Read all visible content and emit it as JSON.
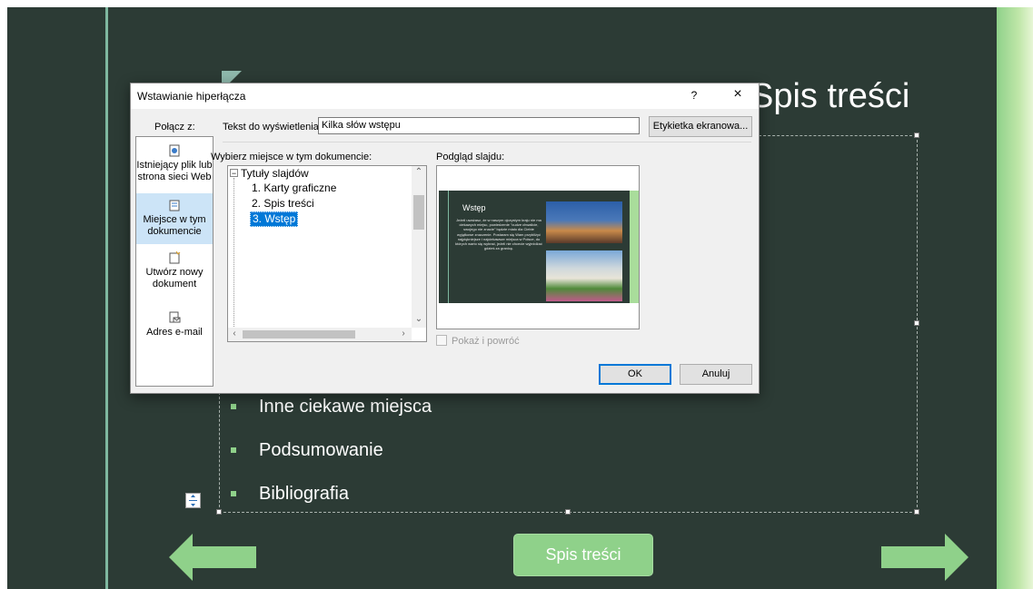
{
  "slide": {
    "title": "Spis treści",
    "bullets": [
      "Inne ciekawe miejsca",
      "Podsumowanie",
      "Bibliografia"
    ],
    "center_button_label": "Spis treści",
    "colors": {
      "background": "#2c3b35",
      "accent": "#8fd18a",
      "center_button": "#8fd18a"
    }
  },
  "dialog": {
    "title": "Wstawianie hiperłącza",
    "help_label": "?",
    "close_label": "×",
    "link_to_label": "Połącz z:",
    "text_to_display_label": "Tekst do wyświetlenia:",
    "text_to_display_value": "Kilka słów wstępu",
    "screentip_button": "Etykietka ekranowa...",
    "select_place_label": "Wybierz miejsce w tym dokumencie:",
    "preview_label": "Podgląd slajdu:",
    "nav_items": [
      {
        "label": "Istniejący plik lub strona sieci Web",
        "icon": "existing-file-icon",
        "selected": false
      },
      {
        "label": "Miejsce w tym dokumencie",
        "icon": "place-in-document-icon",
        "selected": true
      },
      {
        "label": "Utwórz nowy dokument",
        "icon": "new-document-icon",
        "selected": false
      },
      {
        "label": "Adres e-mail",
        "icon": "email-address-icon",
        "selected": false
      }
    ],
    "tree": {
      "root": "Tytuły slajdów",
      "items": [
        {
          "label": "1. Karty graficzne",
          "selected": false
        },
        {
          "label": "2. Spis treści",
          "selected": false
        },
        {
          "label": "3. Wstęp",
          "selected": true
        }
      ]
    },
    "preview": {
      "title": "Wstęp",
      "body": "Jeżeli uważasz, że w naszym ojczystym kraju nie ma ciekawych miejsc, powiedzenie \"cudze chwalicie, swojego nie znacie\" będzie miało dla Ciebie wyjątkowe znaczenie. Postaram się Wam przybliżyć najpiękniejsze i najciekawsze miejsca w Polsce, do których warto się wybrać, jeżeli nie chcecie wyjeżdżać gdzieś za granicę."
    },
    "show_and_return_label": "Pokaż i powróć",
    "show_and_return_checked": false,
    "ok_label": "OK",
    "cancel_label": "Anuluj"
  }
}
